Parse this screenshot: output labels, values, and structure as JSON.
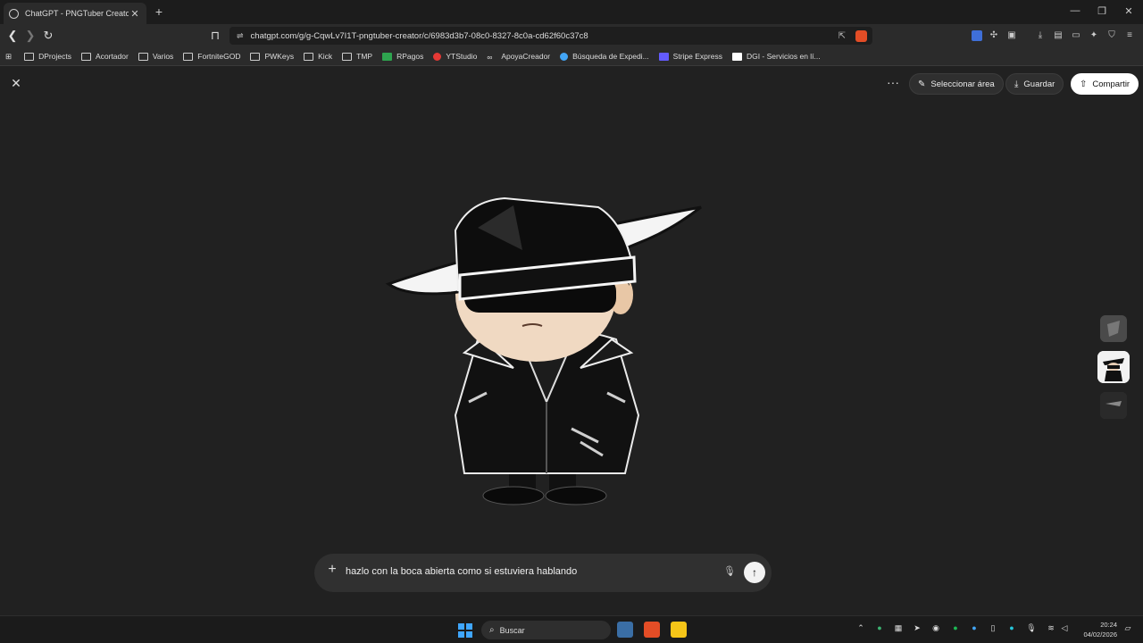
{
  "browser": {
    "tab_title": "ChatGPT - PNGTuber Creator",
    "url": "chatgpt.com/g/g-CqwLv7I1T-pngtuber-creator/c/6983d3b7-08c0-8327-8c0a-cd62f60c37c8",
    "bookmarks": [
      "DProjects",
      "Acortador",
      "Varios",
      "FortniteGOD",
      "PWKeys",
      "Kick",
      "TMP",
      "RPagos",
      "YTStudio",
      "ApoyaCreador",
      "Búsqueda de Expedi...",
      "Stripe Express",
      "DGI - Servicios en lí..."
    ]
  },
  "viewer": {
    "select_area_label": "Seleccionar área",
    "save_label": "Guardar",
    "share_label": "Compartir",
    "image_description": "chibi detective character in black fedora and trench coat"
  },
  "composer": {
    "value": "hazlo con la boca abierta como si estuviera hablando"
  },
  "taskbar": {
    "search_placeholder": "Buscar",
    "time": "20:24",
    "date": "04/02/2026"
  },
  "colors": {
    "background": "#212121",
    "accent_brave": "#e34d26",
    "windows_blue": "#3fa6ff"
  }
}
